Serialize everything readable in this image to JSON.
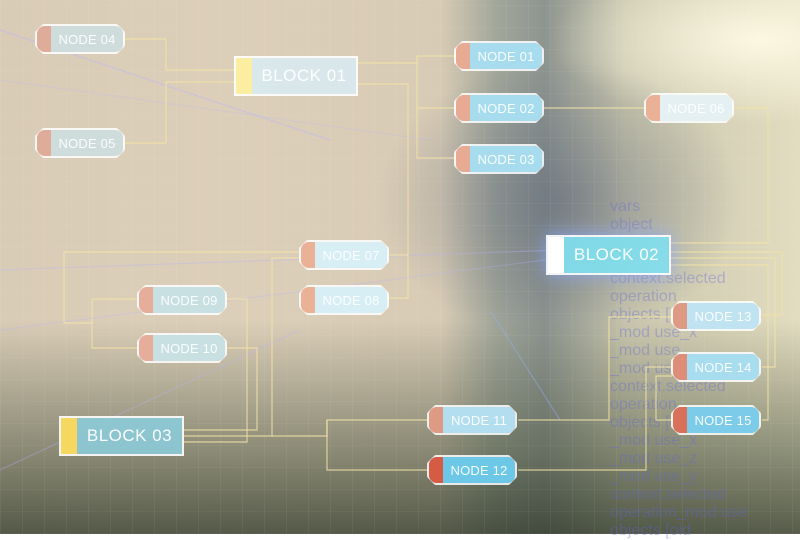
{
  "diagram": {
    "type": "flowchart",
    "blocks": [
      {
        "id": "block-01",
        "label": "BLOCK 01",
        "tab_color": "#fbeea0",
        "body_color": "#d8eef7"
      },
      {
        "id": "block-02",
        "label": "BLOCK 02",
        "tab_color": "#ffffff",
        "body_color": "#7fe0ef"
      },
      {
        "id": "block-03",
        "label": "BLOCK 03",
        "tab_color": "#f6d860",
        "body_color": "#8ccbd8"
      }
    ],
    "nodes": [
      {
        "id": "node-01",
        "label": "NODE 01",
        "tab_color": "#e7ab94",
        "body_color": "#a7dcef"
      },
      {
        "id": "node-02",
        "label": "NODE 02",
        "tab_color": "#e7ab94",
        "body_color": "#a7dcef"
      },
      {
        "id": "node-03",
        "label": "NODE 03",
        "tab_color": "#e7ab94",
        "body_color": "#a7dcef"
      },
      {
        "id": "node-04",
        "label": "NODE 04",
        "tab_color": "#dfac99",
        "body_color": "#cfdcdc"
      },
      {
        "id": "node-05",
        "label": "NODE 05",
        "tab_color": "#dfac99",
        "body_color": "#cfdcdc"
      },
      {
        "id": "node-06",
        "label": "NODE 06",
        "tab_color": "#eab196",
        "body_color": "#e4f0f2"
      },
      {
        "id": "node-07",
        "label": "NODE 07",
        "tab_color": "#eab196",
        "body_color": "#d6eef4"
      },
      {
        "id": "node-08",
        "label": "NODE 08",
        "tab_color": "#eab196",
        "body_color": "#d6eef4"
      },
      {
        "id": "node-09",
        "label": "NODE 09",
        "tab_color": "#e6ae9a",
        "body_color": "#c8e0e2"
      },
      {
        "id": "node-10",
        "label": "NODE 10",
        "tab_color": "#e6ae9a",
        "body_color": "#c8e0e2"
      },
      {
        "id": "node-11",
        "label": "NODE 11",
        "tab_color": "#df9a85",
        "body_color": "#b2def0"
      },
      {
        "id": "node-12",
        "label": "NODE 12",
        "tab_color": "#d65b45",
        "body_color": "#6cc8e6"
      },
      {
        "id": "node-13",
        "label": "NODE 13",
        "tab_color": "#de9a84",
        "body_color": "#bfe3f0"
      },
      {
        "id": "node-14",
        "label": "NODE 14",
        "tab_color": "#de8e78",
        "body_color": "#a8dcef"
      },
      {
        "id": "node-15",
        "label": "NODE 15",
        "tab_color": "#d9705a",
        "body_color": "#7ccbe8"
      }
    ],
    "edges": [
      [
        "node-04",
        "block-01"
      ],
      [
        "node-05",
        "block-01"
      ],
      [
        "block-01",
        "node-01"
      ],
      [
        "block-01",
        "node-02"
      ],
      [
        "block-01",
        "node-03"
      ],
      [
        "block-01",
        "node-08"
      ],
      [
        "node-02",
        "node-06"
      ],
      [
        "node-06",
        "block-02"
      ],
      [
        "node-07",
        "node-09"
      ],
      [
        "node-07",
        "node-10"
      ],
      [
        "node-09",
        "block-03"
      ],
      [
        "node-10",
        "block-03"
      ],
      [
        "node-07",
        "block-03"
      ],
      [
        "block-03",
        "node-11"
      ],
      [
        "block-03",
        "node-12"
      ],
      [
        "block-02",
        "node-13"
      ],
      [
        "block-02",
        "node-14"
      ],
      [
        "block-02",
        "node-15"
      ],
      [
        "node-13",
        "node-11"
      ],
      [
        "node-14",
        "node-12"
      ],
      [
        "node-14",
        "node-15"
      ]
    ],
    "line_color": "#f3e3a6",
    "background_code_lines": [
      "vars",
      "object",
      "",
      "",
      "context.selected",
      "operation",
      "objects [",
      "_mod use_x",
      "_mod use_",
      "_mod use",
      "context.selected",
      "operation",
      "objects [old name]",
      "_mod use_x",
      "_mod use_z",
      "_mod use_y",
      "context.selected",
      "operation_mod use",
      "objects [old"
    ]
  }
}
